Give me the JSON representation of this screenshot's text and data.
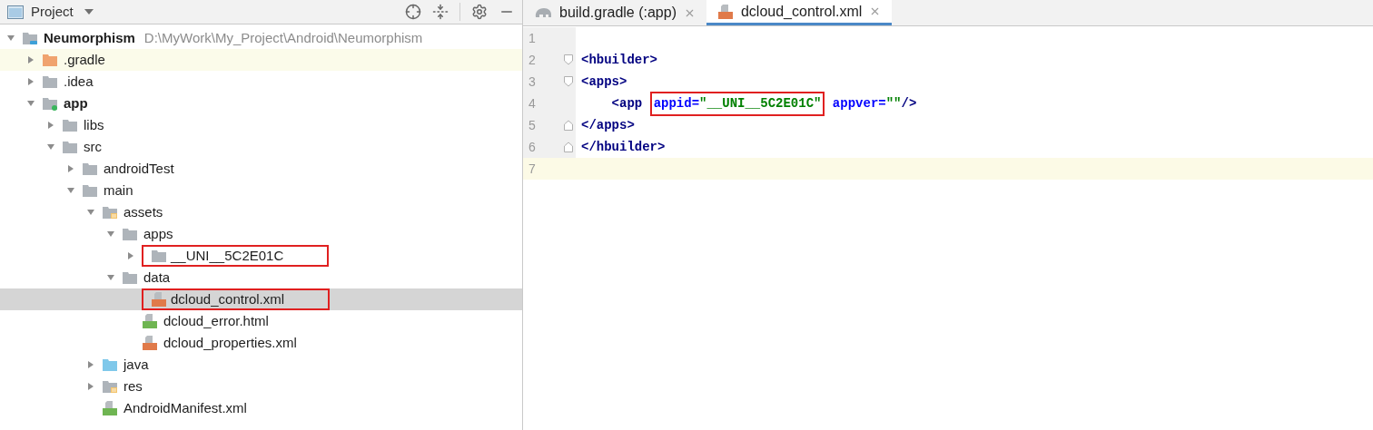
{
  "project_panel": {
    "title": "Project",
    "tree": [
      {
        "label": "Neumorphism",
        "path": "D:\\MyWork\\My_Project\\Android\\Neumorphism",
        "kind": "project",
        "bold": true,
        "expanded": true,
        "selected": false,
        "highlighted": false,
        "outlined": false,
        "children": [
          {
            "label": ".gradle",
            "kind": "excluded-folder",
            "bold": false,
            "expanded": false,
            "selected": false,
            "highlighted": true,
            "outlined": false
          },
          {
            "label": ".idea",
            "kind": "folder",
            "bold": false,
            "expanded": false,
            "selected": false,
            "highlighted": false,
            "outlined": false
          },
          {
            "label": "app",
            "kind": "module",
            "bold": true,
            "expanded": true,
            "selected": false,
            "highlighted": false,
            "outlined": false,
            "children": [
              {
                "label": "libs",
                "kind": "folder",
                "bold": false,
                "expanded": false,
                "selected": false,
                "highlighted": false,
                "outlined": false
              },
              {
                "label": "src",
                "kind": "folder",
                "bold": false,
                "expanded": true,
                "selected": false,
                "highlighted": false,
                "outlined": false,
                "children": [
                  {
                    "label": "androidTest",
                    "kind": "folder",
                    "bold": false,
                    "expanded": false,
                    "selected": false,
                    "highlighted": false,
                    "outlined": false
                  },
                  {
                    "label": "main",
                    "kind": "folder",
                    "bold": false,
                    "expanded": true,
                    "selected": false,
                    "highlighted": false,
                    "outlined": false,
                    "children": [
                      {
                        "label": "assets",
                        "kind": "resource-folder",
                        "bold": false,
                        "expanded": true,
                        "selected": false,
                        "highlighted": false,
                        "outlined": false,
                        "children": [
                          {
                            "label": "apps",
                            "kind": "folder",
                            "bold": false,
                            "expanded": true,
                            "selected": false,
                            "highlighted": false,
                            "outlined": false,
                            "children": [
                              {
                                "label": "__UNI__5C2E01C",
                                "kind": "folder",
                                "bold": false,
                                "expanded": false,
                                "selected": false,
                                "highlighted": false,
                                "outlined": true
                              }
                            ]
                          },
                          {
                            "label": "data",
                            "kind": "folder",
                            "bold": false,
                            "expanded": true,
                            "selected": false,
                            "highlighted": false,
                            "outlined": false,
                            "children": [
                              {
                                "label": "dcloud_control.xml",
                                "kind": "xml-file",
                                "bold": false,
                                "selected": true,
                                "highlighted": false,
                                "outlined": true
                              },
                              {
                                "label": "dcloud_error.html",
                                "kind": "html-file",
                                "bold": false,
                                "selected": false,
                                "highlighted": false,
                                "outlined": false
                              },
                              {
                                "label": "dcloud_properties.xml",
                                "kind": "xml-file",
                                "bold": false,
                                "selected": false,
                                "highlighted": false,
                                "outlined": false
                              }
                            ]
                          }
                        ]
                      },
                      {
                        "label": "java",
                        "kind": "source-folder",
                        "bold": false,
                        "expanded": false,
                        "selected": false,
                        "highlighted": false,
                        "outlined": false
                      },
                      {
                        "label": "res",
                        "kind": "resource-folder",
                        "bold": false,
                        "expanded": false,
                        "selected": false,
                        "highlighted": false,
                        "outlined": false
                      },
                      {
                        "label": "AndroidManifest.xml",
                        "kind": "manifest-file",
                        "bold": false,
                        "selected": false,
                        "highlighted": false,
                        "outlined": false
                      }
                    ]
                  }
                ]
              }
            ]
          }
        ]
      }
    ]
  },
  "editor": {
    "tabs": [
      {
        "label": "build.gradle (:app)",
        "kind": "gradle-file",
        "selected": false
      },
      {
        "label": "dcloud_control.xml",
        "kind": "xml-file",
        "selected": true
      }
    ],
    "lines": [
      {
        "number": "1",
        "fold_start": false,
        "fold_end": false,
        "current": false
      },
      {
        "number": "2",
        "fold_start": true,
        "fold_end": false,
        "current": false,
        "segments": [
          {
            "kind": "tag",
            "text": "<hbuilder>"
          }
        ]
      },
      {
        "number": "3",
        "fold_start": true,
        "fold_end": false,
        "current": false,
        "segments": [
          {
            "kind": "tag",
            "text": "<apps>"
          }
        ]
      },
      {
        "number": "4",
        "fold_start": false,
        "fold_end": false,
        "current": false,
        "segments": [
          {
            "kind": "tag",
            "text": "    <app "
          },
          {
            "kind": "boxed",
            "segments": [
              {
                "kind": "attr",
                "text": "appid="
              },
              {
                "kind": "value",
                "text": "\"__UNI__5C2E01C\""
              }
            ]
          },
          {
            "kind": "attr",
            "text": " appver="
          },
          {
            "kind": "value",
            "text": "\"\""
          },
          {
            "kind": "tag",
            "text": "/>"
          }
        ]
      },
      {
        "number": "5",
        "fold_start": false,
        "fold_end": true,
        "current": false,
        "segments": [
          {
            "kind": "tag",
            "text": "</apps>"
          }
        ]
      },
      {
        "number": "6",
        "fold_start": false,
        "fold_end": true,
        "current": false,
        "segments": [
          {
            "kind": "tag",
            "text": "</hbuilder>"
          }
        ]
      },
      {
        "number": "7",
        "fold_start": false,
        "fold_end": false,
        "current": true
      }
    ]
  }
}
